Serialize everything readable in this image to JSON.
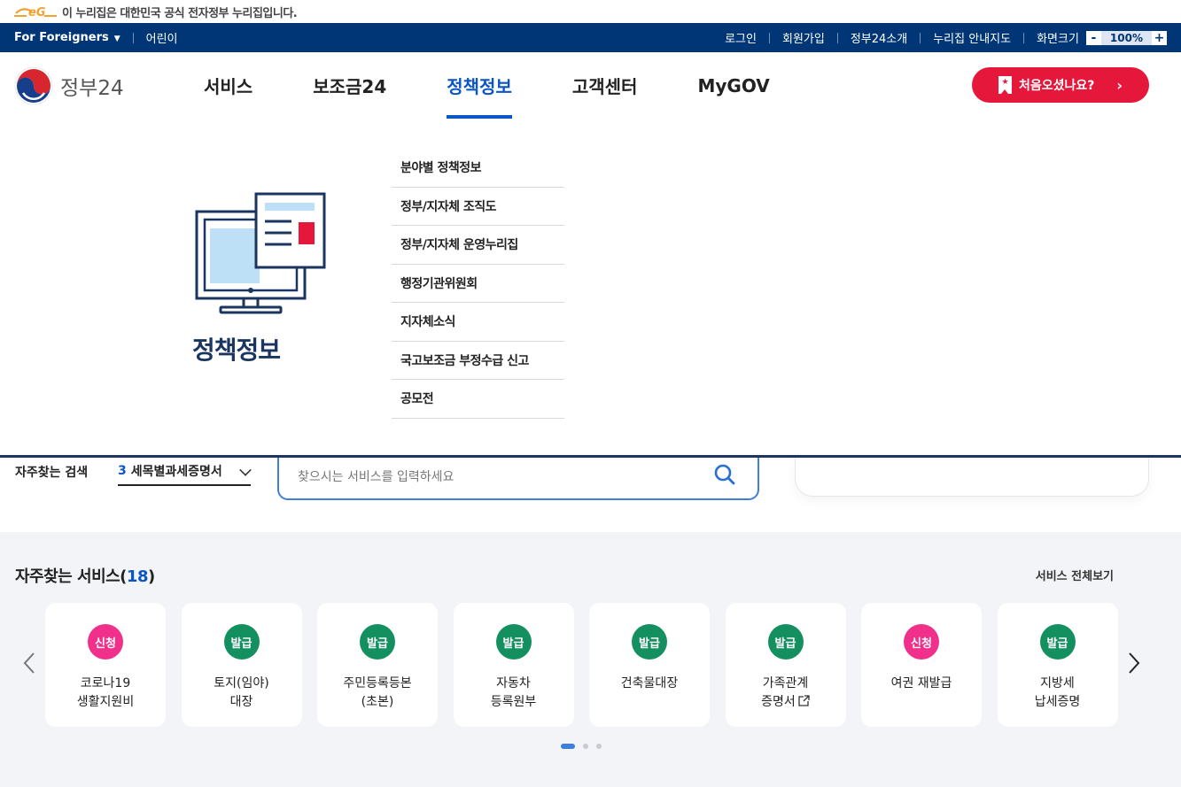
{
  "notice": {
    "text": "이 누리집은 대한민국 공식 전자정부 누리집입니다."
  },
  "topbar": {
    "left": [
      "For Foreigners",
      "어린이"
    ],
    "right": [
      "로그인",
      "회원가입",
      "정부24소개",
      "누리집 안내지도",
      "화면크기"
    ],
    "zoom": "100%",
    "zoom_minus": "-",
    "zoom_plus": "+"
  },
  "header": {
    "logo_text": "정부24",
    "nav": [
      "서비스",
      "보조금24",
      "정책정보",
      "고객센터",
      "MyGOV"
    ],
    "active_index": 2,
    "first_visit_button": "처음오셨나요?",
    "first_visit_arrow": "›"
  },
  "mega_menu": {
    "title": "정책정보",
    "items": [
      "분야별 정책정보",
      "정부/지자체 조직도",
      "정부/지자체 운영누리집",
      "행정기관위원회",
      "지자체소식",
      "국고보조금 부정수급 신고",
      "공모전"
    ]
  },
  "search": {
    "label": "자주찾는 검색",
    "selected_number": "3",
    "selected_text": "세목별과세증명서",
    "placeholder": "찾으시는 서비스를 입력하세요"
  },
  "services": {
    "title": "자주찾는 서비스(",
    "count": "18",
    "title_close": ")",
    "view_all": "서비스 전체보기",
    "cards": [
      {
        "badge": "신청",
        "badge_color": "#f0308a",
        "line1": "코로나19",
        "line2": "생활지원비"
      },
      {
        "badge": "발급",
        "badge_color": "#149060",
        "line1": "토지(임야)",
        "line2": "대장"
      },
      {
        "badge": "발급",
        "badge_color": "#149060",
        "line1": "주민등록등본",
        "line2": "(초본)"
      },
      {
        "badge": "발급",
        "badge_color": "#149060",
        "line1": "자동차",
        "line2": "등록원부"
      },
      {
        "badge": "발급",
        "badge_color": "#149060",
        "line1": "건축물대장",
        "line2": ""
      },
      {
        "badge": "발급",
        "badge_color": "#149060",
        "line1": "가족관계",
        "line2": "증명서",
        "external": true
      },
      {
        "badge": "신청",
        "badge_color": "#f0308a",
        "line1": "여권 재발급",
        "line2": ""
      },
      {
        "badge": "발급",
        "badge_color": "#149060",
        "line1": "지방세",
        "line2": "납세증명"
      }
    ],
    "pagination": {
      "pages": 3,
      "current": 1
    }
  },
  "colors": {
    "navy": "#003675",
    "accent_blue": "#0b56c4",
    "red": "#e5183c",
    "green": "#149060",
    "pink": "#f0308a"
  }
}
